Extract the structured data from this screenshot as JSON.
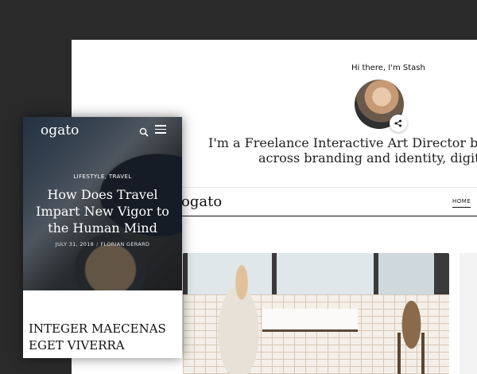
{
  "desktop": {
    "greeting": "Hi there, I'm Stash",
    "intro_line1": "I'm a Freelance Interactive Art Director based in Fra",
    "intro_line2": "across branding and identity, digital and p",
    "logo": "ogato",
    "nav": {
      "home": "HOME"
    }
  },
  "mobile": {
    "logo": "ogato",
    "categories": "LIFESTYLE, TRAVEL",
    "post_title": "How Does Travel Impart New Vigor to the Human Mind",
    "date": "JULY 31, 2018",
    "author": "FLORIAN GERARD",
    "next_post_title": "INTEGER MAECENAS EGET VIVERRA"
  },
  "icons": {
    "share": "share-icon",
    "search": "search-icon",
    "menu": "hamburger-menu-icon"
  }
}
